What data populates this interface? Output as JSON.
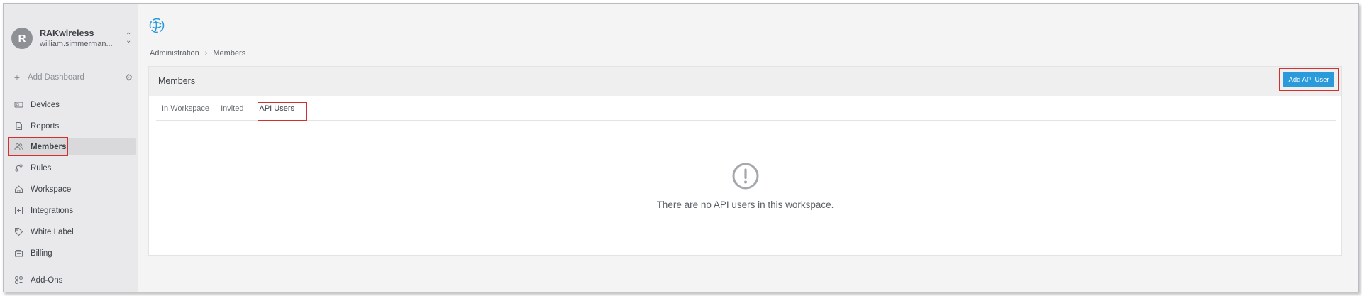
{
  "account": {
    "initial": "R",
    "name": "RAKwireless",
    "email": "william.simmerman..."
  },
  "sidebar": {
    "add_dashboard": "Add Dashboard",
    "items": [
      {
        "label": "Devices",
        "icon": "device-icon"
      },
      {
        "label": "Reports",
        "icon": "report-icon"
      },
      {
        "label": "Members",
        "icon": "members-icon",
        "active": true
      },
      {
        "label": "Rules",
        "icon": "rules-icon"
      },
      {
        "label": "Workspace",
        "icon": "workspace-icon"
      },
      {
        "label": "Integrations",
        "icon": "integrations-icon"
      },
      {
        "label": "White Label",
        "icon": "tag-icon"
      },
      {
        "label": "Billing",
        "icon": "billing-icon"
      },
      {
        "label": "Add-Ons",
        "icon": "addons-icon"
      }
    ]
  },
  "breadcrumb": {
    "parent": "Administration",
    "current": "Members"
  },
  "card": {
    "title": "Members",
    "add_button": "Add API User"
  },
  "tabs": [
    {
      "label": "In Workspace"
    },
    {
      "label": "Invited"
    },
    {
      "label": "API Users",
      "active": true
    }
  ],
  "empty_state": {
    "message": "There are no API users in this workspace."
  },
  "colors": {
    "accent": "#2a9adb",
    "highlight": "#d32f2f",
    "sidebar_bg": "#e9e9eb",
    "content_bg": "#f4f4f5"
  }
}
